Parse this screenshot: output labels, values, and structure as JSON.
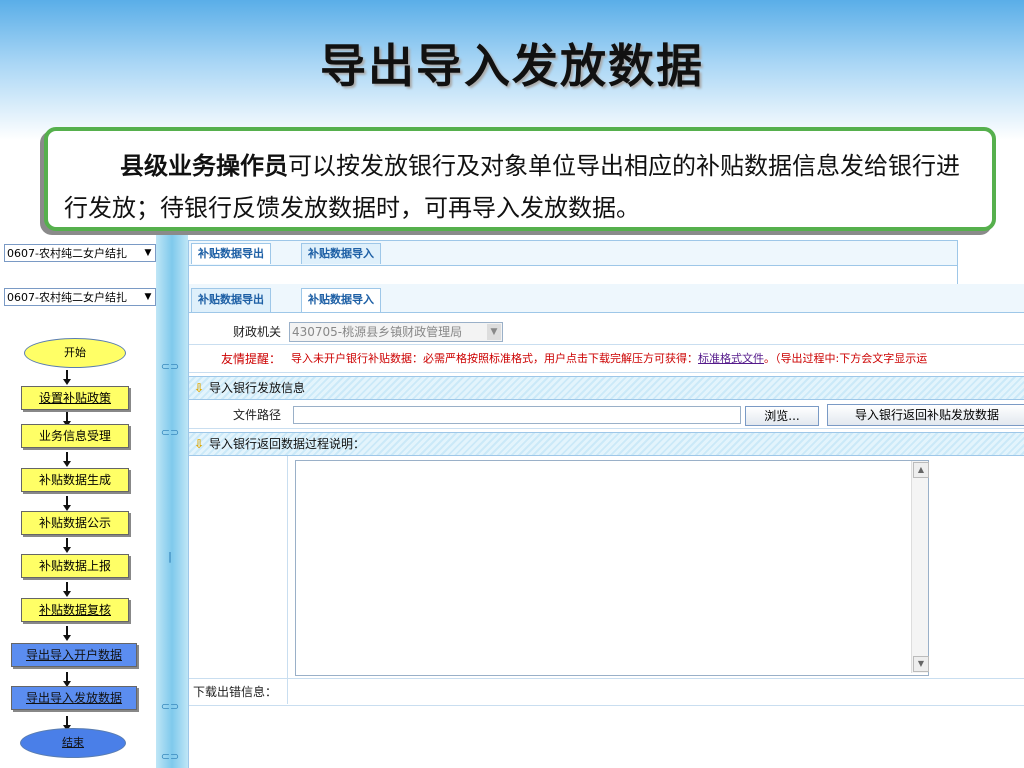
{
  "slide": {
    "title": "导出导入发放数据",
    "callout_strong": "县级业务操作员",
    "callout_rest": "可以按发放银行及对象单位导出相应的补贴数据信息发给银行进行发放；待银行反馈发放数据时，可再导入发放数据。"
  },
  "left": {
    "select1": "0607-农村纯二女户结扎",
    "select2": "0607-农村纯二女户结扎",
    "flow": {
      "start": "开始",
      "steps": [
        "设置补贴政策",
        "业务信息受理",
        "补贴数据生成",
        "补贴数据公示",
        "补贴数据上报",
        "补贴数据复核",
        "导出导入开户数据",
        "导出导入发放数据"
      ],
      "end": "结束"
    }
  },
  "back_panel": {
    "tab_export": "补贴数据导出",
    "tab_import": "补贴数据导入"
  },
  "main": {
    "tab_export": "补贴数据导出",
    "tab_import": "补贴数据导入",
    "finance_label": "财政机关",
    "finance_value": "430705-桃源县乡镇财政管理局",
    "reminder_label": "友情提醒：",
    "reminder_text": "导入未开户银行补贴数据：必需严格按照标准格式，用户点击下载完解压方可获得：",
    "reminder_link": "标准格式文件",
    "reminder_tail": "。（导出过程中:下方会文字显示运",
    "section_import": "导入银行发放信息",
    "path_label": "文件路径",
    "browse_label": "浏览...",
    "import_button": "导入银行返回补贴发放数据",
    "section_process": "导入银行返回数据过程说明：",
    "download_error_label": "下载出错信息："
  },
  "colors": {
    "callout_border": "#56b04d",
    "flow_yellow": "#ffff66",
    "flow_blue": "#5b8df0",
    "reminder_red": "#cc0000"
  }
}
